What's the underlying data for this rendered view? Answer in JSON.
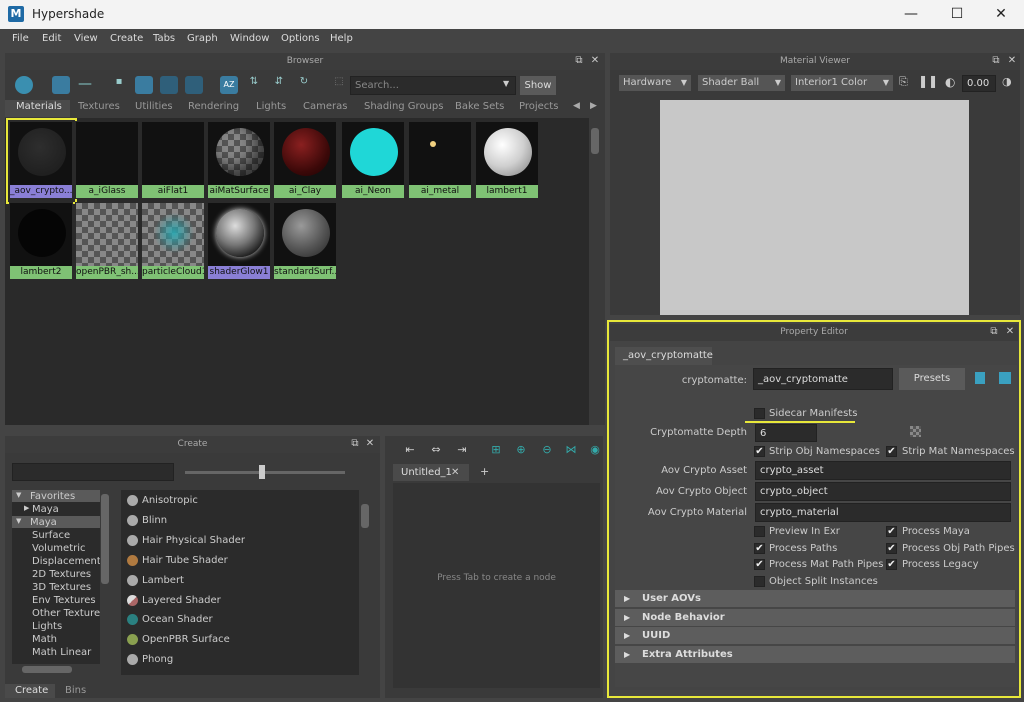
{
  "window": {
    "title": "Hypershade",
    "minimize": "—",
    "maximize": "☐",
    "close": "✕"
  },
  "menu": [
    "File",
    "Edit",
    "View",
    "Create",
    "Tabs",
    "Graph",
    "Window",
    "Options",
    "Help"
  ],
  "browser": {
    "panel_title": "Browser",
    "search_placeholder": "Search...",
    "show_label": "Show",
    "tabs": [
      "Materials",
      "Textures",
      "Utilities",
      "Rendering",
      "Lights",
      "Cameras",
      "Shading Groups",
      "Bake Sets",
      "Projects"
    ],
    "materials": [
      "_aov_crypto...",
      "a_iGlass",
      "aiFlat1",
      "aiMatSurface",
      "ai_Clay",
      "ai_Neon",
      "ai_metal",
      "lambert1",
      "lambert2",
      "openPBR_sh...",
      "particleCloud1",
      "shaderGlow1",
      "standardSurf..."
    ]
  },
  "material_viewer": {
    "panel_title": "Material Viewer",
    "renderer": "Hardware",
    "shape": "Shader Ball",
    "environment": "Interior1 Color",
    "exposure": "0.00"
  },
  "create": {
    "panel_title": "Create",
    "tree": [
      "Favorites",
      "Maya",
      "Maya",
      "Surface",
      "Volumetric",
      "Displacement",
      "2D Textures",
      "3D Textures",
      "Env Textures",
      "Other Textures",
      "Lights",
      "Math",
      "Math Linear"
    ],
    "shaders": [
      "Anisotropic",
      "Blinn",
      "Hair Physical Shader",
      "Hair Tube Shader",
      "Lambert",
      "Layered Shader",
      "Ocean Shader",
      "OpenPBR Surface",
      "Phong"
    ],
    "bottom_tabs": [
      "Create",
      "Bins"
    ]
  },
  "graph": {
    "tab_label": "Untitled_1",
    "tab_close": "✕",
    "add_tab": "+",
    "hint": "Press Tab to create a node"
  },
  "property_editor": {
    "panel_title": "Property Editor",
    "node_tab": "_aov_cryptomatte",
    "node_type_label": "cryptomatte:",
    "node_name": "_aov_cryptomatte",
    "presets_label": "Presets",
    "sidecar_label": "Sidecar Manifests",
    "depth_label": "Cryptomatte Depth",
    "depth_value": "6",
    "strip_obj_label": "Strip Obj Namespaces",
    "strip_mat_label": "Strip Mat Namespaces",
    "asset_label": "Aov Crypto Asset",
    "asset_value": "crypto_asset",
    "object_label": "Aov Crypto Object",
    "object_value": "crypto_object",
    "material_label": "Aov Crypto Material",
    "material_value": "crypto_material",
    "preview_exr": "Preview In Exr",
    "process_maya": "Process Maya",
    "process_paths": "Process Paths",
    "process_obj_pipes": "Process Obj Path Pipes",
    "process_mat_pipes": "Process Mat Path Pipes",
    "process_legacy": "Process Legacy",
    "object_split": "Object Split Instances",
    "sections": [
      "User AOVs",
      "Node Behavior",
      "UUID",
      "Extra Attributes"
    ],
    "checked": {
      "sidecar": false,
      "strip_obj": true,
      "strip_mat": true,
      "preview_exr": false,
      "process_maya": true,
      "process_paths": true,
      "process_obj_pipes": true,
      "process_mat_pipes": true,
      "process_legacy": true,
      "object_split": false
    }
  },
  "colors": {
    "highlight": "#e8e83a",
    "swatch_caption": "#7fc274",
    "selected_caption": "#8a7fd6"
  }
}
